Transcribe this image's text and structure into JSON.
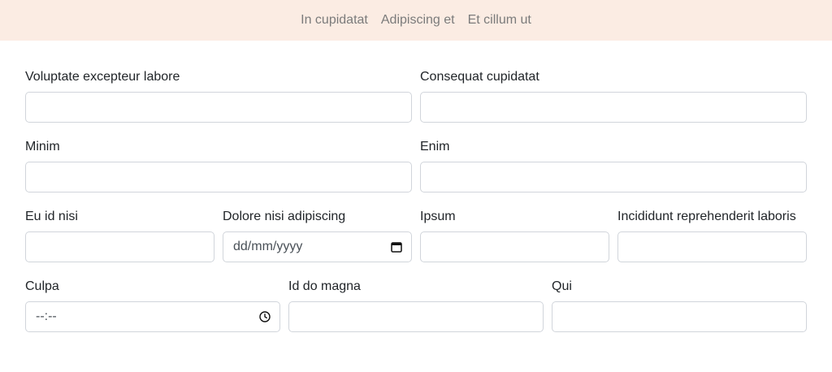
{
  "nav": {
    "links": [
      "In cupidatat",
      "Adipiscing et",
      "Et cillum ut"
    ]
  },
  "form": {
    "fields": [
      {
        "label": "Voluptate excepteur labore",
        "value": ""
      },
      {
        "label": "Consequat cupidatat",
        "value": ""
      },
      {
        "label": "Minim",
        "value": ""
      },
      {
        "label": "Enim",
        "value": ""
      },
      {
        "label": "Eu id nisi",
        "value": ""
      },
      {
        "label": "Dolore nisi adipiscing",
        "value": "",
        "placeholder": "dd/mm/yyyy",
        "icon": "calendar-icon"
      },
      {
        "label": "Ipsum",
        "value": ""
      },
      {
        "label": "Incididunt reprehenderit laboris",
        "value": ""
      },
      {
        "label": "Culpa",
        "value": "",
        "placeholder": "--:--",
        "icon": "clock-icon"
      },
      {
        "label": "Id do magna",
        "value": ""
      },
      {
        "label": "Qui",
        "value": ""
      }
    ]
  }
}
